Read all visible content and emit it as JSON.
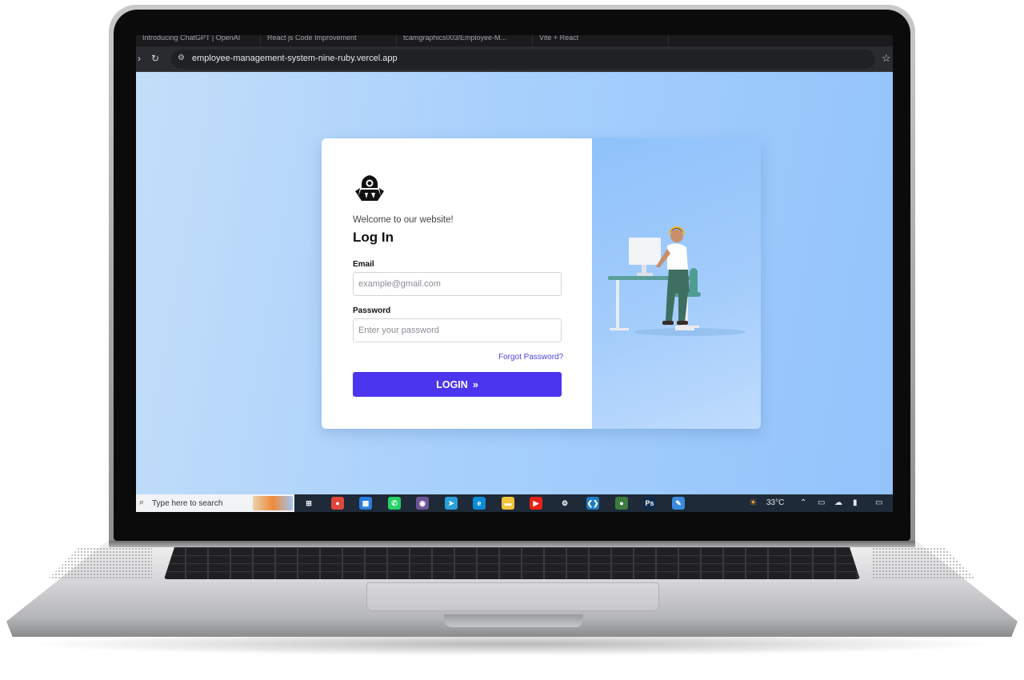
{
  "browser": {
    "tabs": [
      {
        "label": "Introducing ChatGPT | OpenAI"
      },
      {
        "label": "React js Code Improvement"
      },
      {
        "label": "tcamgraphics003/Employee-M..."
      },
      {
        "label": "Vite + React"
      }
    ],
    "url": "employee-management-system-nine-ruby.vercel.app"
  },
  "login": {
    "welcome": "Welcome to our website!",
    "title": "Log In",
    "email_label": "Email",
    "email_placeholder": "example@gmail.com",
    "password_label": "Password",
    "password_placeholder": "Enter your password",
    "forgot_password": "Forgot Password?",
    "button_label": "LOGIN",
    "button_icon": "»"
  },
  "taskbar": {
    "search_placeholder": "Type here to search",
    "weather": "33°C",
    "apps": [
      {
        "name": "task-view",
        "glyph": "⊞",
        "color": "#1e2a38"
      },
      {
        "name": "chrome",
        "glyph": "●",
        "color": "#e0463a"
      },
      {
        "name": "microsoft-store",
        "glyph": "▦",
        "color": "#2a7de1"
      },
      {
        "name": "whatsapp",
        "glyph": "✆",
        "color": "#25d366"
      },
      {
        "name": "github-desktop",
        "glyph": "◉",
        "color": "#6e5494"
      },
      {
        "name": "telegram",
        "glyph": "➤",
        "color": "#2aa0da"
      },
      {
        "name": "edge",
        "glyph": "e",
        "color": "#0c8bd6"
      },
      {
        "name": "file-explorer",
        "glyph": "▬",
        "color": "#f2c43b"
      },
      {
        "name": "youtube",
        "glyph": "▶",
        "color": "#e62117"
      },
      {
        "name": "settings",
        "glyph": "⚙",
        "color": "#1e2a38"
      },
      {
        "name": "vscode",
        "glyph": "❮❯",
        "color": "#1f7ac4"
      },
      {
        "name": "chrome-active",
        "glyph": "●",
        "color": "#3c7a3f"
      },
      {
        "name": "photoshop",
        "glyph": "Ps",
        "color": "#0f2c4d"
      },
      {
        "name": "paint",
        "glyph": "✎",
        "color": "#3a8ae0"
      }
    ]
  },
  "colors": {
    "primary": "#4c35ee",
    "page_bg": "#a8d0fc"
  }
}
